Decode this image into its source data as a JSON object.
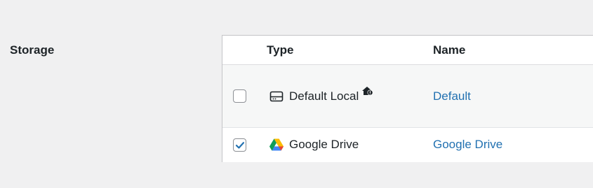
{
  "section": {
    "label": "Storage"
  },
  "table": {
    "columns": {
      "type": "Type",
      "name": "Name"
    },
    "rows": [
      {
        "checked": false,
        "type_icon": "hard-drive-icon",
        "type_label": "Default Local",
        "badge_icon": "home-icon",
        "name": "Default"
      },
      {
        "checked": true,
        "type_icon": "google-drive-icon",
        "type_label": "Google Drive",
        "name": "Google Drive"
      }
    ]
  },
  "colors": {
    "link": "#2271b1",
    "checkmark": "#2271b1",
    "background": "#f0f0f1"
  }
}
